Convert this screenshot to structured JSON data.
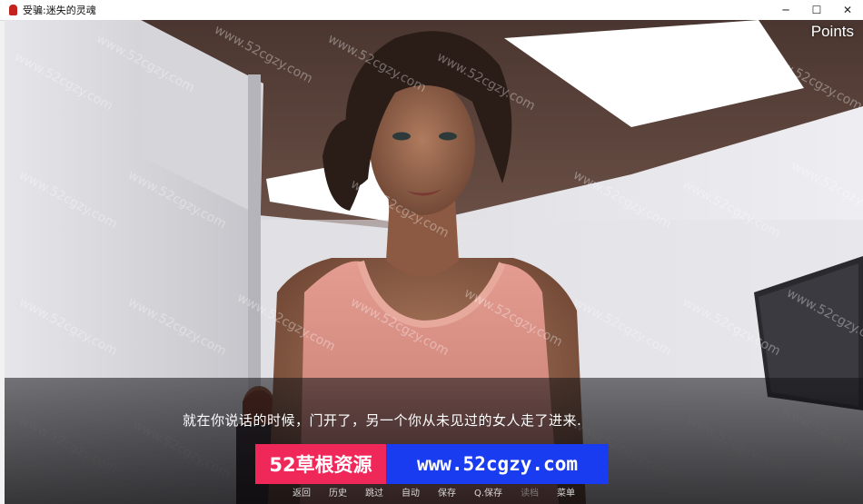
{
  "window": {
    "title": "受骗:迷失的灵魂",
    "minimize": "─",
    "maximize": "☐",
    "close": "✕"
  },
  "hud": {
    "points_label": "Points"
  },
  "dialogue": {
    "text": "就在你说话的时候，门开了，另一个你从未见过的女人走了进来."
  },
  "banner": {
    "left_text": "52草根资源",
    "right_text": "www.52cgzy.com",
    "left_color": "#f0285a",
    "right_color": "#1a3cf0"
  },
  "watermark": {
    "text": "www.52cgzy.com"
  },
  "quick_menu": [
    {
      "label": "返回",
      "enabled": true
    },
    {
      "label": "历史",
      "enabled": true
    },
    {
      "label": "跳过",
      "enabled": true
    },
    {
      "label": "自动",
      "enabled": true
    },
    {
      "label": "保存",
      "enabled": true
    },
    {
      "label": "Q.保存",
      "enabled": true
    },
    {
      "label": "读档",
      "enabled": false
    },
    {
      "label": "菜单",
      "enabled": true
    }
  ]
}
